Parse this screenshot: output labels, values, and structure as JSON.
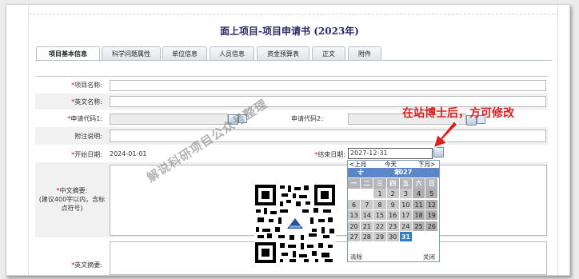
{
  "page_title": "面上项目-项目申请书 (2023年)",
  "tabs": [
    {
      "label": "项目基本信息",
      "active": true
    },
    {
      "label": "科学问题属性",
      "active": false
    },
    {
      "label": "单位信息",
      "active": false
    },
    {
      "label": "人员信息",
      "active": false
    },
    {
      "label": "资金预算表",
      "active": false
    },
    {
      "label": "正文",
      "active": false
    },
    {
      "label": "附件",
      "active": false
    }
  ],
  "form": {
    "required_mark": "*",
    "project_name_label": "项目名称:",
    "english_name_label": "英文名称:",
    "apply_code1_label": "申请代码1:",
    "apply_code2_label": "申请代码2:",
    "note_label": "附注说明:",
    "start_date_label": "开始日期:",
    "start_date_value": "2024-01-01",
    "end_date_label": "结束日期:",
    "end_date_value": "2027-12-31",
    "cn_abstract_label": "中文摘要:",
    "cn_abstract_hint": "(建议400字以内，含标点符号)",
    "en_abstract_label": "英文摘要:"
  },
  "annotation": {
    "note": "在站博士后，方可修改",
    "watermark": "解说科研项目公众号整理",
    "arrow_color": "#e0201e"
  },
  "calendar": {
    "prev": "<上月",
    "today": "今天",
    "next": "下月>",
    "month": "十二月",
    "year": "2027",
    "year_suffix": "年",
    "weekdays": [
      "一",
      "二",
      "三",
      "四",
      "五",
      "六",
      "日"
    ],
    "weeks": [
      [
        "",
        "",
        "1",
        "2",
        "3",
        "4",
        "5"
      ],
      [
        "6",
        "7",
        "8",
        "9",
        "10",
        "11",
        "12"
      ],
      [
        "13",
        "14",
        "15",
        "16",
        "17",
        "18",
        "19"
      ],
      [
        "20",
        "21",
        "22",
        "23",
        "24",
        "25",
        "26"
      ],
      [
        "27",
        "28",
        "29",
        "30",
        "31",
        "",
        ""
      ]
    ],
    "selected": "31",
    "clear": "清除",
    "close": "关闭"
  },
  "colors": {
    "title": "#2a2a6a",
    "calendar_header": "#5b87c2",
    "selected_day": "#2f7ec8",
    "required": "#d00000"
  },
  "icons": [
    "lookup-icon",
    "calendar-icon",
    "qr-code-icon",
    "arrow-icon",
    "chevron-down-icon"
  ]
}
